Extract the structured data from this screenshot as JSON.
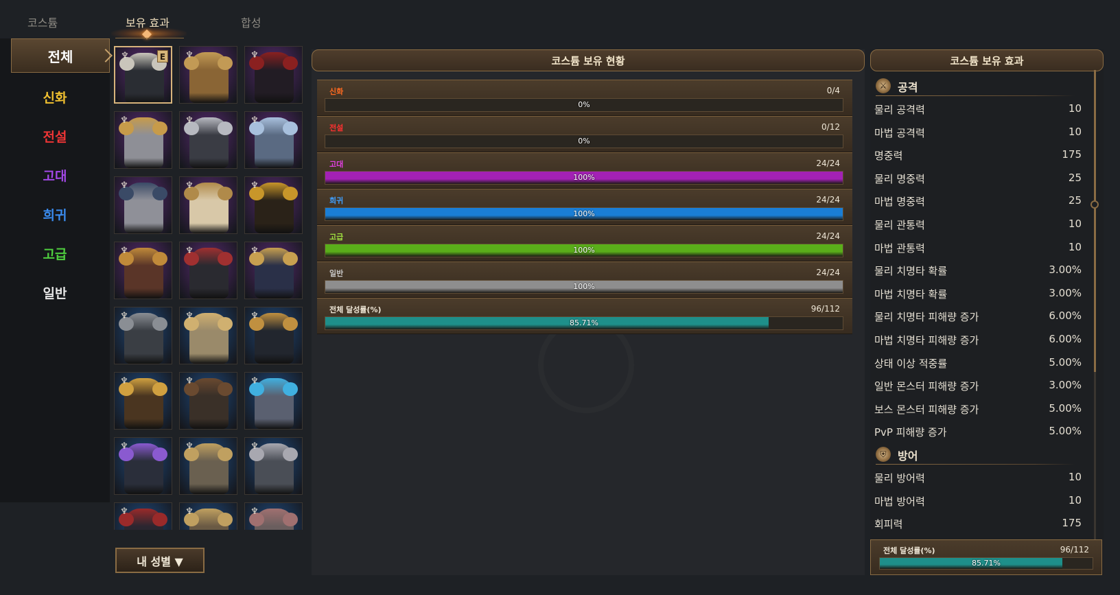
{
  "top_tabs": [
    {
      "label": "코스튬",
      "active": false
    },
    {
      "label": "보유 효과",
      "active": true
    },
    {
      "label": "합성",
      "active": false
    }
  ],
  "categories": [
    {
      "label": "전체",
      "color": "#ffffff",
      "active": true
    },
    {
      "label": "신화",
      "color": "#f0c030"
    },
    {
      "label": "전설",
      "color": "#ee3535"
    },
    {
      "label": "고대",
      "color": "#a348e8"
    },
    {
      "label": "희귀",
      "color": "#3a8cf0"
    },
    {
      "label": "고급",
      "color": "#4fcf3f"
    },
    {
      "label": "일반",
      "color": "#e6e6e6"
    }
  ],
  "costume_items": [
    {
      "bg": "#5a2a72",
      "armor": "#2a2d33",
      "trim": "#c9c5bb",
      "equipped": true
    },
    {
      "bg": "#5a2a72",
      "armor": "#8a6535",
      "trim": "#c29a55"
    },
    {
      "bg": "#5a2a72",
      "armor": "#221c24",
      "trim": "#8a2020"
    },
    {
      "bg": "#5a2a72",
      "armor": "#8e8f96",
      "trim": "#c79b4a"
    },
    {
      "bg": "#5a2a72",
      "armor": "#3a3c44",
      "trim": "#b7b9c0"
    },
    {
      "bg": "#5a2a72",
      "armor": "#5a6a82",
      "trim": "#a8c0dd"
    },
    {
      "bg": "#5a2a72",
      "armor": "#8f9098",
      "trim": "#3a4a66"
    },
    {
      "bg": "#5a2a72",
      "armor": "#d8c8a8",
      "trim": "#b08a4a"
    },
    {
      "bg": "#5a2a72",
      "armor": "#2a2218",
      "trim": "#c8962a"
    },
    {
      "bg": "#5a2a72",
      "armor": "#5a3528",
      "trim": "#c08a3a"
    },
    {
      "bg": "#5a2a72",
      "armor": "#2a2a30",
      "trim": "#a03030"
    },
    {
      "bg": "#5a2a72",
      "armor": "#2a3048",
      "trim": "#c8a050"
    },
    {
      "bg": "#1f4a7e",
      "armor": "#3a3e44",
      "trim": "#8a8e94"
    },
    {
      "bg": "#1f4a7e",
      "armor": "#9a8a6a",
      "trim": "#d0b070"
    },
    {
      "bg": "#1f4a7e",
      "armor": "#22262e",
      "trim": "#c09040"
    },
    {
      "bg": "#1f4a7e",
      "armor": "#4a3520",
      "trim": "#d0a040"
    },
    {
      "bg": "#1f4a7e",
      "armor": "#3a3028",
      "trim": "#6a4a30"
    },
    {
      "bg": "#1f4a7e",
      "armor": "#5a6070",
      "trim": "#40b0e0"
    },
    {
      "bg": "#1f4a7e",
      "armor": "#2a2e3a",
      "trim": "#8a5ad0"
    },
    {
      "bg": "#1f4a7e",
      "armor": "#6a6050",
      "trim": "#c0a060"
    },
    {
      "bg": "#1f4a7e",
      "armor": "#4a4e56",
      "trim": "#a8a8b0"
    },
    {
      "bg": "#1f4a7e",
      "armor": "#2a2630",
      "trim": "#9a2a2a"
    },
    {
      "bg": "#1f4a7e",
      "armor": "#6a5a44",
      "trim": "#c0a060"
    },
    {
      "bg": "#1f4a7e",
      "armor": "#6a5e5e",
      "trim": "#a07070"
    }
  ],
  "gender_button": "내 성별 ▼",
  "center": {
    "title": "코스튬 보유 현황",
    "rarity_rows": [
      {
        "label": "신화",
        "label_color": "#ff6a20",
        "count": "0/4",
        "percent_text": "0%",
        "fill_fraction": 0.0,
        "fill_color": "#888"
      },
      {
        "label": "전설",
        "label_color": "#ff3030",
        "count": "0/12",
        "percent_text": "0%",
        "fill_fraction": 0.0,
        "fill_color": "#888"
      },
      {
        "label": "고대",
        "label_color": "#e040e0",
        "count": "24/24",
        "percent_text": "100%",
        "fill_fraction": 1.0,
        "fill_color": "#a321b5"
      },
      {
        "label": "희귀",
        "label_color": "#40a0ff",
        "count": "24/24",
        "percent_text": "100%",
        "fill_fraction": 1.0,
        "fill_color": "#1a7ed6"
      },
      {
        "label": "고급",
        "label_color": "#a0e040",
        "count": "24/24",
        "percent_text": "100%",
        "fill_fraction": 1.0,
        "fill_color": "#5aae1a"
      },
      {
        "label": "일반",
        "label_color": "#c8c8c8",
        "count": "24/24",
        "percent_text": "100%",
        "fill_fraction": 1.0,
        "fill_color": "#8e8e8e"
      },
      {
        "label": "전체 달성률(%)",
        "label_color": "#f0e8d8",
        "count": "96/112",
        "percent_text": "85.71%",
        "fill_fraction": 0.8571,
        "fill_color": "#1e8f8a"
      }
    ]
  },
  "right": {
    "title": "코스튬 보유 효과",
    "sections": [
      {
        "title": "공격",
        "stats": [
          {
            "name": "물리 공격력",
            "value": "10"
          },
          {
            "name": "마법 공격력",
            "value": "10"
          },
          {
            "name": "명중력",
            "value": "175"
          },
          {
            "name": "물리 명중력",
            "value": "25"
          },
          {
            "name": "마법 명중력",
            "value": "25"
          },
          {
            "name": "물리 관통력",
            "value": "10"
          },
          {
            "name": "마법 관통력",
            "value": "10"
          },
          {
            "name": "물리 치명타 확률",
            "value": "3.00%"
          },
          {
            "name": "마법 치명타 확률",
            "value": "3.00%"
          },
          {
            "name": "물리 치명타 피해량 증가",
            "value": "6.00%"
          },
          {
            "name": "마법 치명타 피해량 증가",
            "value": "6.00%"
          },
          {
            "name": "상태 이상 적중률",
            "value": "5.00%"
          },
          {
            "name": "일반 몬스터 피해량 증가",
            "value": "3.00%"
          },
          {
            "name": "보스 몬스터 피해량 증가",
            "value": "5.00%"
          },
          {
            "name": "PvP 피해량 증가",
            "value": "5.00%"
          }
        ]
      },
      {
        "title": "방어",
        "stats": [
          {
            "name": "물리 방어력",
            "value": "10"
          },
          {
            "name": "마법 방어력",
            "value": "10"
          },
          {
            "name": "회피력",
            "value": "175"
          }
        ]
      }
    ],
    "total": {
      "label": "전체 달성률(%)",
      "count": "96/112",
      "percent_text": "85.71%",
      "fill_fraction": 0.8571,
      "fill_color": "#1e8f8a"
    }
  }
}
